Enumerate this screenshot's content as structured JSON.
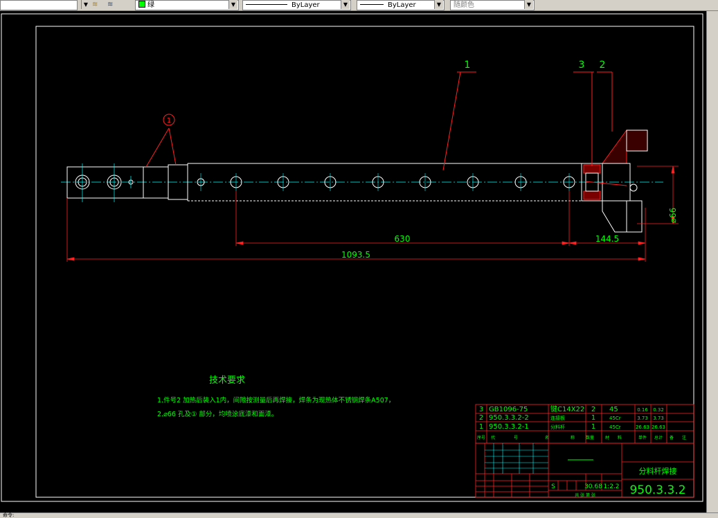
{
  "toolbar": {
    "color_label": "绿",
    "linetype_label": "ByLayer",
    "lineweight_label": "ByLayer",
    "plotstyle_label": "随颜色"
  },
  "drawing": {
    "balloon_1": "1",
    "balloon_2": "2",
    "balloon_3": "3",
    "weld_circle": "1",
    "dim_630": "630",
    "dim_1445": "144.5",
    "dim_10935": "1093.5",
    "dim_dia66": "⌀66",
    "tech_title": "技术要求",
    "tech_line1": "1.件号2 加热后装入1内，间隙按测量后再焊接，焊条为现热体不锈钢焊条A507，",
    "tech_line2": "2.⌀66 孔及① 部分，均喷涂底漆和面漆。"
  },
  "bom": {
    "rows": [
      {
        "no": "3",
        "code": "GB1096-75",
        "name": "键C14X22",
        "qty": "2",
        "mat": "45",
        "w1": "0.16",
        "w2": "0.32"
      },
      {
        "no": "2",
        "code": "950.3.3.2-2",
        "name": "连接板",
        "qty": "1",
        "mat": "45Cr",
        "w1": "3.73",
        "w2": "3.73"
      },
      {
        "no": "1",
        "code": "950.3.3.2-1",
        "name": "分料杆",
        "qty": "1",
        "mat": "45Cr",
        "w1": "26.63",
        "w2": "26.63"
      }
    ],
    "header": [
      "序号",
      "代",
      "号",
      "名",
      "称",
      "数量",
      "材",
      "料",
      "单件",
      "总计",
      "备",
      "注"
    ]
  },
  "titleblock": {
    "part_name": "分料杆焊接",
    "drawing_no": "950.3.3.2",
    "weight": "30.68",
    "scale": "1:2.2",
    "stage": "S",
    "sheet_label": "共 张 第 张"
  },
  "status": {
    "text": "命令:"
  }
}
